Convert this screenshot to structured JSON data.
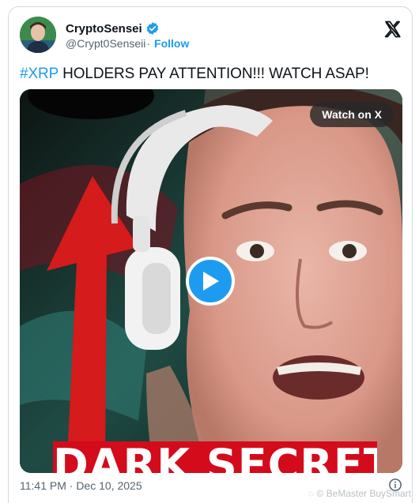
{
  "author": {
    "display_name": "CryptoSensei",
    "handle": "@Crypt0Senseii",
    "separator": "·",
    "follow_label": "Follow",
    "verified": true,
    "avatar_icon": "user-avatar"
  },
  "tweet": {
    "hashtag": "#XRP",
    "text": " HOLDERS PAY ATTENTION!!! WATCH ASAP!"
  },
  "media": {
    "watch_label": "Watch on X",
    "overlay_caption": "DARK SECRETS",
    "play_icon": "play-icon"
  },
  "footer": {
    "timestamp": "11:41 PM · Dec 10, 2025",
    "info_icon": "info-icon"
  },
  "watermark": "BeMaster BuySmart",
  "colors": {
    "accent": "#1d9bf0",
    "text_primary": "#0f1419",
    "text_secondary": "#536471",
    "caption_red": "#d40b1b"
  }
}
